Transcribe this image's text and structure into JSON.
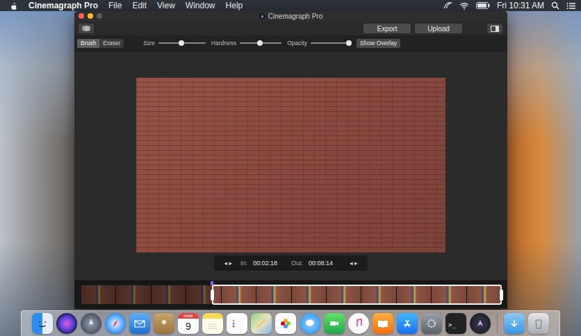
{
  "menubar": {
    "app": "Cinemagraph Pro",
    "menus": [
      "File",
      "Edit",
      "View",
      "Window",
      "Help"
    ],
    "clock": "Fri 10:31 AM"
  },
  "window": {
    "title": "Cinemagraph Pro",
    "zoom_enabled": false
  },
  "toolbar": {
    "buttons": [
      "Export",
      "Upload"
    ]
  },
  "tools": [
    {
      "label": "Brush",
      "selected": true
    },
    {
      "label": "Eraser",
      "selected": false
    }
  ],
  "sliders": [
    {
      "label": "Size",
      "level": 0.49
    },
    {
      "label": "Hardness",
      "level": 0.48
    },
    {
      "label": "Opacity",
      "level": 0.95
    }
  ],
  "overlay_button": {
    "label": "Show Overlay"
  },
  "trim": {
    "in": {
      "nav": "◂ ▸",
      "label": "In:",
      "value": "00:02:18"
    },
    "out": {
      "label": "Out:",
      "value": "00:08:14",
      "nav": "◂ ▸"
    }
  },
  "timeline": {
    "frame_count": 12,
    "selection_start": 0.31,
    "selection_end": 1.0,
    "playhead": 0.31
  },
  "dock": {
    "calendar_month": "MAR",
    "calendar_day": "9",
    "terminal_prompt": ">_"
  }
}
